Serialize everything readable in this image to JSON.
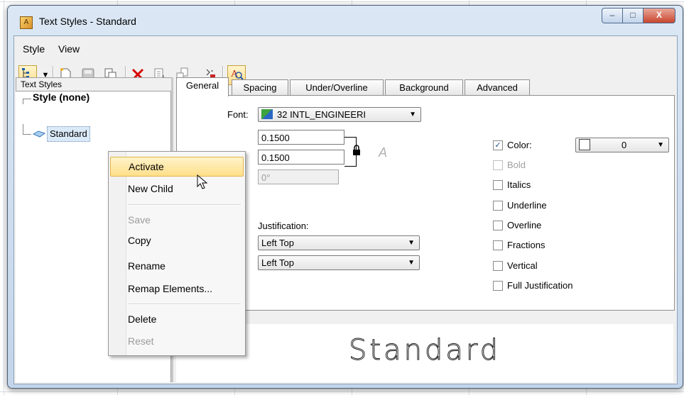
{
  "window": {
    "title": "Text Styles - Standard"
  },
  "caption": {
    "minimize": "–",
    "maximize": "□",
    "close": "X"
  },
  "menu": [
    "Style",
    "View"
  ],
  "toolbar": {
    "icons": [
      "tree-view-icon",
      "dropdown-arrow-icon",
      "new-style-icon",
      "save-icon",
      "copy-icon",
      "delete-icon",
      "rename-icon",
      "remap-icon",
      "reset-icon",
      "preview-icon"
    ]
  },
  "tree": {
    "header": "Text Styles",
    "root": "Style (none)",
    "node": "Standard"
  },
  "tabs": [
    "General",
    "Spacing",
    "Under/Overline",
    "Background",
    "Advanced"
  ],
  "general": {
    "font_label": "Font:",
    "font_value": "32  INTL_ENGINEERI",
    "width_value": "0.1500",
    "height_value": "0.1500",
    "slant_value": "0°",
    "justification_label": "Justification:",
    "justification_value": "Left Top",
    "justification_value2": "Left Top"
  },
  "options": {
    "color_label": "Color:",
    "color_value": "0",
    "bold": "Bold",
    "italics": "Italics",
    "underline": "Underline",
    "overline": "Overline",
    "fractions": "Fractions",
    "vertical": "Vertical",
    "full_justification": "Full Justification"
  },
  "preview_text": "Standard",
  "context_menu": {
    "activate": "Activate",
    "new_child": "New Child",
    "save": "Save",
    "copy": "Copy",
    "rename": "Rename",
    "remap": "Remap Elements...",
    "delete": "Delete",
    "reset": "Reset"
  },
  "colors": {
    "hover": "#ffdf8a",
    "accent": "#c5a23a",
    "delete": "#d60000"
  }
}
